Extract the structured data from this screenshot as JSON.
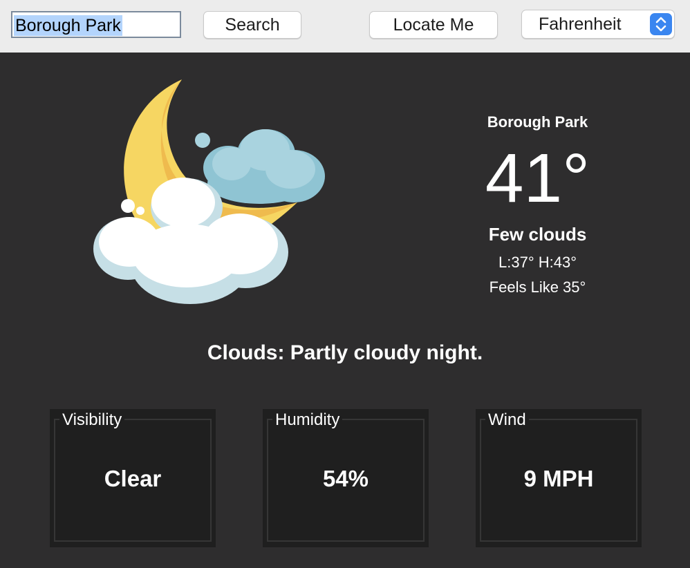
{
  "toolbar": {
    "search_value": "Borough Park",
    "search_label": "Search",
    "locate_label": "Locate Me",
    "unit_selected": "Fahrenheit"
  },
  "icon": {
    "name": "moon-clouds-icon"
  },
  "weather": {
    "city": "Borough Park",
    "temperature": "41°",
    "condition": "Few clouds",
    "low_high": "L:37° H:43°",
    "feels_like": "Feels Like 35°",
    "description": "Clouds: Partly cloudy night."
  },
  "cards": [
    {
      "label": "Visibility",
      "value": "Clear"
    },
    {
      "label": "Humidity",
      "value": "54%"
    },
    {
      "label": "Wind",
      "value": "9 MPH"
    }
  ],
  "colors": {
    "background": "#2e2d2e",
    "toolbar": "#ececec",
    "card": "#1f1f1f",
    "select_accent": "#3a86f0",
    "selection": "#b3d4fc"
  }
}
